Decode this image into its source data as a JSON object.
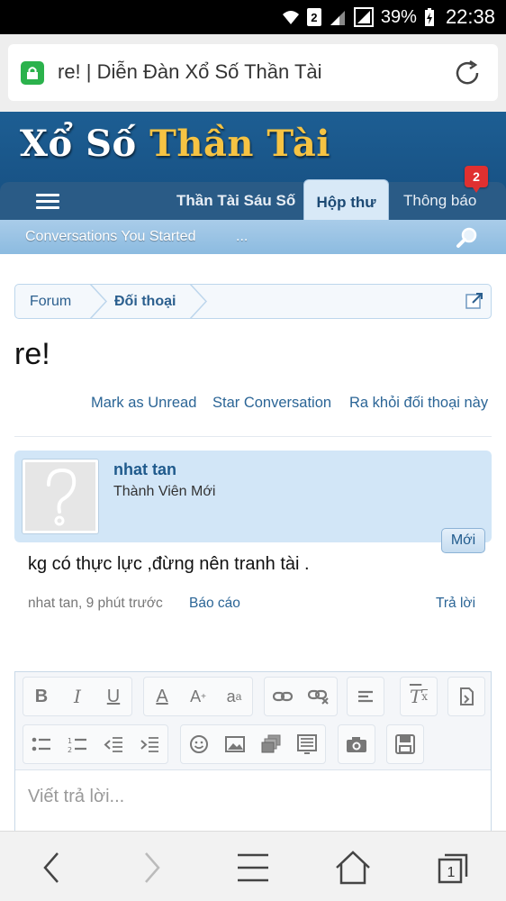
{
  "status_bar": {
    "battery": "39%",
    "time": "22:38",
    "sim": "2"
  },
  "browser": {
    "url_title": "re! | Diễn Đàn Xổ Số Thần Tài",
    "tab_count": "1"
  },
  "site": {
    "logo_part1": "Xổ Số",
    "logo_part2": "Thần Tài",
    "nav": {
      "sau_so": "Thần Tài Sáu Số",
      "hop_thu": "Hộp thư",
      "thong_bao": "Thông báo",
      "notification_count": "2"
    },
    "subnav": {
      "conversations": "Conversations You Started",
      "more": "..."
    }
  },
  "breadcrumb": {
    "forum": "Forum",
    "doi_thoai": "Đối thoại"
  },
  "page": {
    "title": "re!"
  },
  "actions": {
    "mark_unread": "Mark as Unread",
    "star": "Star Conversation",
    "leave": "Ra khỏi đối thoại này"
  },
  "message": {
    "username": "nhat tan",
    "user_title": "Thành Viên Mới",
    "new_label": "Mới",
    "body": "kg có thực lực ,đừng nên tranh tài .",
    "meta": "nhat tan, 9 phút trước",
    "report": "Báo cáo",
    "reply": "Trả lời"
  },
  "editor": {
    "placeholder": "Viết trả lời...",
    "tools_row1": [
      "bold-icon",
      "italic-icon",
      "underline-icon",
      "font-color-icon",
      "font-size-icon",
      "font-family-icon",
      "link-icon",
      "unlink-icon",
      "align-icon",
      "remove-format-icon",
      "toggle-bbcode-icon"
    ],
    "tools_row2": [
      "bullet-list-icon",
      "numbered-list-icon",
      "outdent-icon",
      "indent-icon",
      "smilie-icon",
      "image-icon",
      "media-icon",
      "code-icon",
      "camera-icon",
      "save-draft-icon"
    ]
  }
}
